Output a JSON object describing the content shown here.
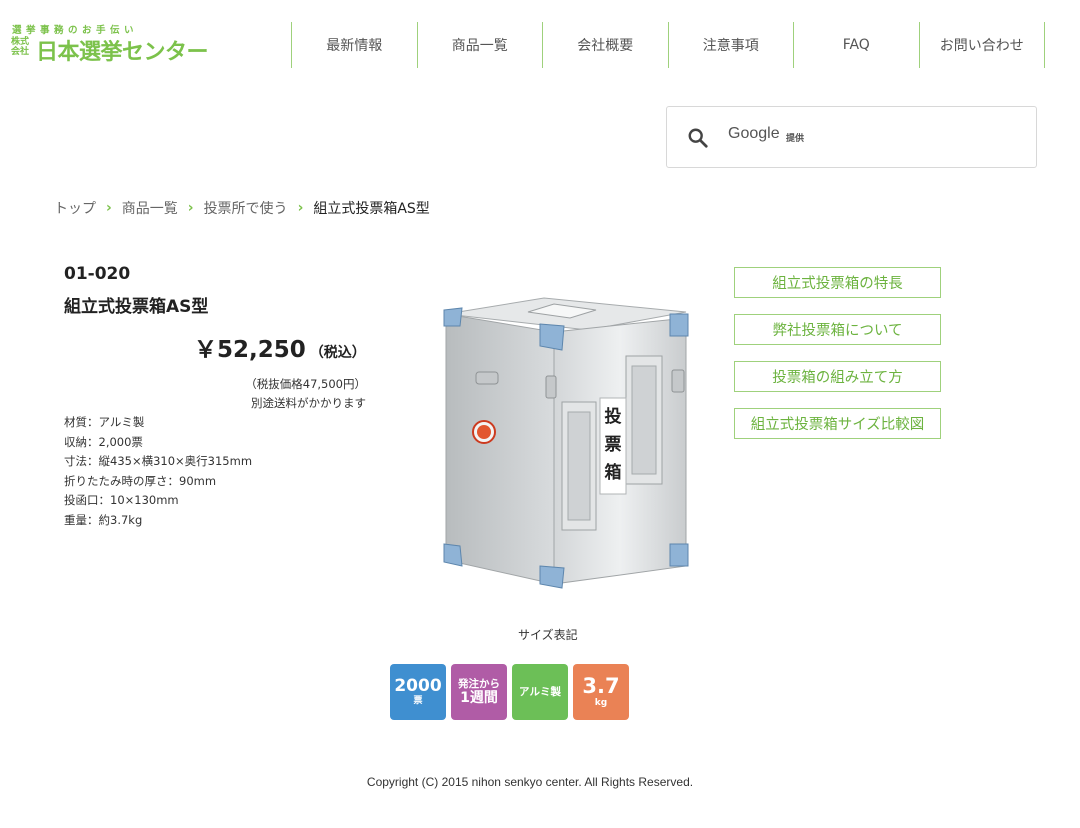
{
  "logo": {
    "tagline": "選挙事務のお手伝い",
    "kaisha": "株式会社",
    "name": "日本選挙センター"
  },
  "nav": [
    "最新情報",
    "商品一覧",
    "会社概要",
    "注意事項",
    "FAQ",
    "お問い合わせ"
  ],
  "search": {
    "google": "Google",
    "teikyo": "提供"
  },
  "breadcrumb": {
    "items": [
      "トップ",
      "商品一覧",
      "投票所で使う"
    ],
    "current": "組立式投票箱AS型",
    "separator": "›"
  },
  "product": {
    "code": "01-020",
    "title": "組立式投票箱AS型",
    "price": "￥52,250",
    "price_tax": "（税込）",
    "price_excl": "（税抜価格47,500円）",
    "shipping_note": "別途送料がかかります",
    "specs": [
      "材質：アルミ製",
      "収納：2,000票",
      "寸法：縦435×横310×奥行315mm",
      "折りたたみ時の厚さ：90mm",
      "投函口：10×130mm",
      "重量：約3.7kg"
    ],
    "box_label": "投票箱"
  },
  "side_links": [
    "組立式投票箱の特長",
    "弊社投票箱について",
    "投票箱の組み立て方",
    "組立式投票箱サイズ比較図"
  ],
  "size_label": "サイズ表記",
  "badges": {
    "capacity_value": "2000",
    "capacity_unit": "票",
    "lead_top": "発注から",
    "lead_bottom": "1週間",
    "material": "アルミ製",
    "weight_value": "3.7",
    "weight_unit": "kg"
  },
  "colors": {
    "brand_green": "#7cc24b",
    "nav_divider": "#9fd17c",
    "badge_blue": "#3f8fd0",
    "badge_purple": "#b05ca6",
    "badge_green": "#6cbf57",
    "badge_orange": "#ea8255"
  },
  "copyright": "Copyright (C) 2015 nihon senkyo center. All Rights Reserved."
}
